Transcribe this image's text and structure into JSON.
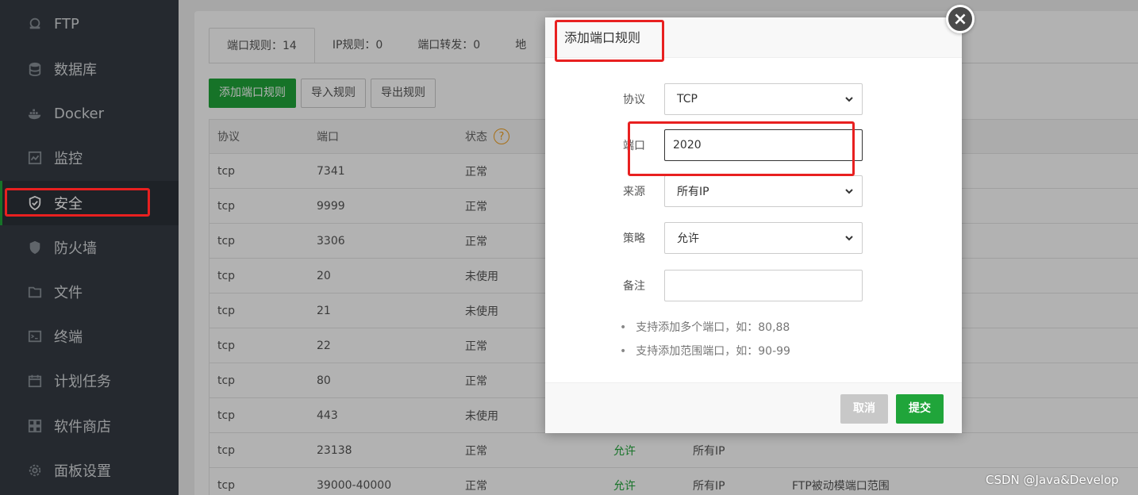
{
  "sidebar": {
    "items": [
      {
        "label": "FTP",
        "icon": "ftp-icon"
      },
      {
        "label": "数据库",
        "icon": "database-icon"
      },
      {
        "label": "Docker",
        "icon": "docker-icon"
      },
      {
        "label": "监控",
        "icon": "monitor-icon"
      },
      {
        "label": "安全",
        "icon": "shield-icon",
        "active": true
      },
      {
        "label": "防火墙",
        "icon": "firewall-icon"
      },
      {
        "label": "文件",
        "icon": "folder-icon"
      },
      {
        "label": "终端",
        "icon": "terminal-icon"
      },
      {
        "label": "计划任务",
        "icon": "calendar-icon"
      },
      {
        "label": "软件商店",
        "icon": "apps-icon"
      },
      {
        "label": "面板设置",
        "icon": "gear-icon"
      }
    ]
  },
  "tabs": [
    {
      "label": "端口规则：14"
    },
    {
      "label": "IP规则：0"
    },
    {
      "label": "端口转发：0"
    },
    {
      "label": "地"
    }
  ],
  "toolbar": {
    "add_label": "添加端口规则",
    "import_label": "导入规则",
    "export_label": "导出规则"
  },
  "table": {
    "headers": [
      "协议",
      "端口",
      "状态"
    ],
    "rows": [
      {
        "protocol": "tcp",
        "port": "7341",
        "status": "正常",
        "policy": "",
        "source": "",
        "note": ""
      },
      {
        "protocol": "tcp",
        "port": "9999",
        "status": "正常",
        "policy": "",
        "source": "",
        "note": ""
      },
      {
        "protocol": "tcp",
        "port": "3306",
        "status": "正常",
        "policy": "",
        "source": "",
        "note": ""
      },
      {
        "protocol": "tcp",
        "port": "20",
        "status": "未使用",
        "policy": "",
        "source": "",
        "note": ""
      },
      {
        "protocol": "tcp",
        "port": "21",
        "status": "未使用",
        "policy": "",
        "source": "",
        "note": ""
      },
      {
        "protocol": "tcp",
        "port": "22",
        "status": "正常",
        "policy": "",
        "source": "",
        "note": ""
      },
      {
        "protocol": "tcp",
        "port": "80",
        "status": "正常",
        "policy": "",
        "source": "",
        "note": ""
      },
      {
        "protocol": "tcp",
        "port": "443",
        "status": "未使用",
        "policy": "",
        "source": "",
        "note": ""
      },
      {
        "protocol": "tcp",
        "port": "23138",
        "status": "正常",
        "policy": "允许",
        "source": "所有IP",
        "note": ""
      },
      {
        "protocol": "tcp",
        "port": "39000-40000",
        "status": "正常",
        "policy": "允许",
        "source": "所有IP",
        "note": "FTP被动模端口范围"
      }
    ]
  },
  "dialog": {
    "title": "添加端口规则",
    "close_glyph": "×",
    "protocol_label": "协议",
    "protocol_value": "TCP",
    "port_label": "端口",
    "port_value": "2020",
    "source_label": "来源",
    "source_value": "所有IP",
    "policy_label": "策略",
    "policy_value": "允许",
    "note_label": "备注",
    "note_value": "",
    "hints": [
      "支持添加多个端口，如：80,88",
      "支持添加范围端口，如：90-99"
    ],
    "cancel_label": "取消",
    "submit_label": "提交"
  },
  "colors": {
    "accent": "#20a53a",
    "sidebar": "#353c44",
    "annotation": "#e82020"
  },
  "watermark": "CSDN @Java&Develop"
}
